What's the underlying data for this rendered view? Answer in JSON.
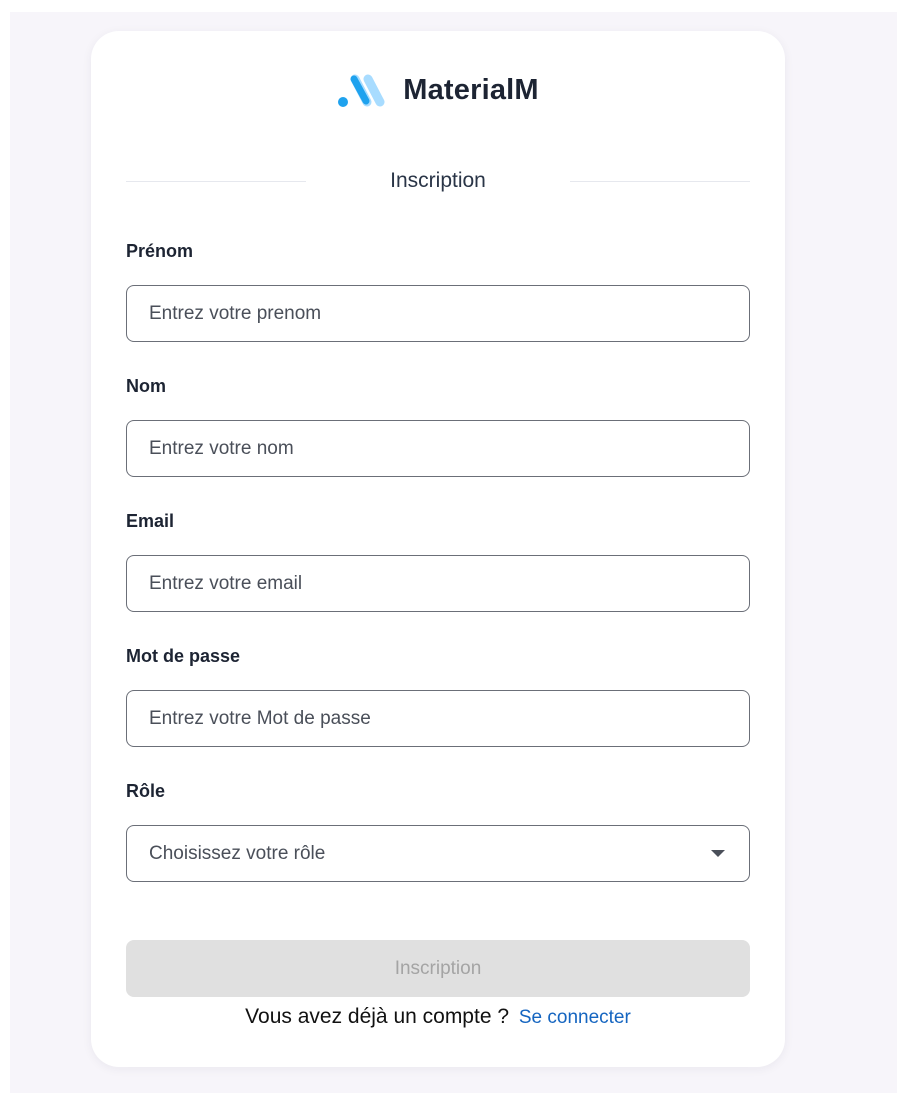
{
  "brand": {
    "name": "MaterialM",
    "colors": {
      "dark": "#1fa2ee",
      "light": "#a8dcff"
    }
  },
  "form": {
    "heading": "Inscription",
    "fields": [
      {
        "label": "Prénom",
        "placeholder": "Entrez votre prenom",
        "type": "text"
      },
      {
        "label": "Nom",
        "placeholder": "Entrez votre nom",
        "type": "text"
      },
      {
        "label": "Email",
        "placeholder": "Entrez votre email",
        "type": "email"
      },
      {
        "label": "Mot de passe",
        "placeholder": "Entrez votre Mot de passe",
        "type": "password"
      }
    ],
    "role": {
      "label": "Rôle",
      "placeholder": "Choisissez votre rôle"
    },
    "submit_label": "Inscription",
    "submit_disabled": true
  },
  "footer": {
    "prompt": "Vous avez déjà un compte ?",
    "link_label": "Se connecter"
  },
  "colors": {
    "background": "#f7f5fa",
    "card": "#ffffff",
    "link": "#1565c0",
    "button_disabled_bg": "#e0e0e0",
    "button_disabled_text": "#a4a4a4"
  }
}
